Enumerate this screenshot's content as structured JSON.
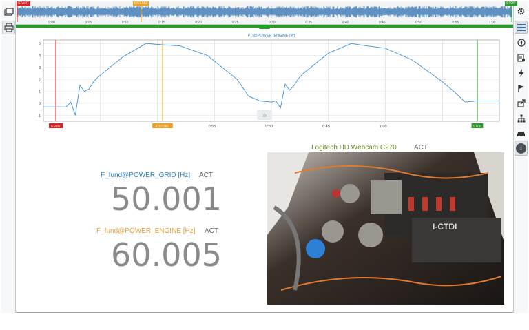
{
  "overview": {
    "start_label": "START",
    "cursor_label": "0:57.582",
    "stop_label": "STOP",
    "tick_labels": [
      "0:00",
      "0:05",
      "0:10",
      "0:15",
      "0:20",
      "0:25",
      "0:30",
      "0:35",
      "0:40",
      "0:45",
      "0:50",
      "0:55",
      "1:00"
    ]
  },
  "chart": {
    "title": "P_t@POWER_ENGINE [W]",
    "y_ticks": [
      "5",
      "4",
      "3",
      "2",
      "1",
      "0",
      "-1"
    ],
    "x_ticks": [
      "0:55",
      "0:30",
      "0:45",
      "1:00"
    ],
    "start_label": "START",
    "cursor_label": "0:57.582",
    "stop_label": "STOP",
    "expand_button": "»"
  },
  "chart_data": {
    "type": "line",
    "title": "P_t@POWER_ENGINE [W]",
    "xlabel": "",
    "ylabel": "",
    "ylim": [
      -1.5,
      5.3
    ],
    "series": [
      {
        "name": "P_t@POWER_ENGINE [W]",
        "x": [
          0,
          0.1,
          0.12,
          0.14,
          0.16,
          0.18,
          0.2,
          0.22,
          0.24,
          0.35,
          0.45,
          0.52,
          0.6,
          0.72,
          0.85,
          0.9,
          0.95,
          1.0,
          1.0,
          1.02,
          1.04,
          1.06,
          1.08,
          1.1,
          1.12,
          1.14,
          1.25,
          1.35,
          1.42,
          1.5,
          1.62,
          1.75,
          1.8,
          1.85,
          1.9,
          2.0
        ],
        "values": [
          -0.3,
          -0.3,
          0.1,
          -1.0,
          1.5,
          1.0,
          1.2,
          1.8,
          2.2,
          3.9,
          5.0,
          4.9,
          4.8,
          4.0,
          2.0,
          0.6,
          0.2,
          0.1,
          0.1,
          0.2,
          -0.4,
          1.6,
          1.1,
          1.5,
          2.1,
          2.5,
          4.2,
          5.0,
          4.8,
          4.6,
          3.6,
          1.8,
          1.0,
          0.1,
          0.2,
          0.2
        ]
      }
    ]
  },
  "measurements": [
    {
      "label": "F_fund@POWER_GRID [Hz]",
      "act": "ACT",
      "value": "50.001",
      "color": "#2f86c8"
    },
    {
      "label": "F_fund@POWER_ENGINE [Hz]",
      "act": "ACT",
      "value": "60.005",
      "color": "#e9a23b"
    }
  ],
  "webcam": {
    "title": "Logitech HD Webcam C270 ",
    "act": "ACT",
    "engine_badge": "I-CTDI"
  },
  "icons": {
    "left": [
      "layers-icon",
      "printer-icon"
    ],
    "right": [
      "settings-gear-icon",
      "list-icon",
      "compass-icon",
      "report-icon",
      "lightning-icon",
      "flag-icon",
      "export-icon",
      "network-icon",
      "car-icon",
      "info-icon"
    ]
  },
  "colors": {
    "start": "#e02020",
    "cursor": "#f0a020",
    "stop": "#2a9a2a",
    "line": "#3a8fd6"
  }
}
